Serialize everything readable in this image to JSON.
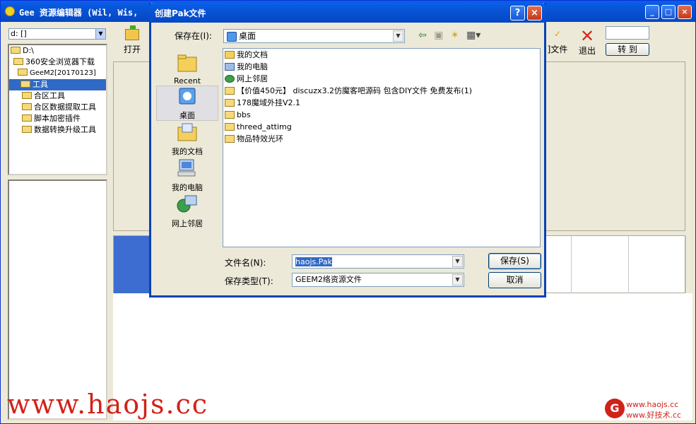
{
  "main_window": {
    "title": "Gee 资源编辑器 (Wil, Wis,",
    "controls": {
      "minimize": "_",
      "maximize": "□",
      "close": "×"
    }
  },
  "left_panel": {
    "drive": "d: []",
    "tree": [
      {
        "label": "D:\\",
        "selected": false
      },
      {
        "label": "360安全浏览器下载",
        "selected": false
      },
      {
        "label": "GeeM2[20170123]",
        "selected": false
      },
      {
        "label": "工具",
        "selected": true
      },
      {
        "label": "合区工具",
        "selected": false
      },
      {
        "label": "合区数据提取工具",
        "selected": false
      },
      {
        "label": "脚本加密插件",
        "selected": false
      },
      {
        "label": "数据转换升级工具",
        "selected": false
      }
    ]
  },
  "toolbar": {
    "open_label": "打开",
    "file_label": "]文件",
    "exit_label": "退出",
    "goto_value": "",
    "goto_label": "转 到"
  },
  "dialog": {
    "title": "创建Pak文件",
    "help": "?",
    "close": "×",
    "save_in_label": "保存在(I):",
    "save_in_value": "桌面",
    "places": [
      "Recent",
      "桌面",
      "我的文档",
      "我的电脑",
      "网上邻居"
    ],
    "files": [
      {
        "name": "我的文档",
        "icon": "my-documents-icon"
      },
      {
        "name": "我的电脑",
        "icon": "my-computer-icon"
      },
      {
        "name": "网上邻居",
        "icon": "network-icon"
      },
      {
        "name": "【价值450元】 discuzx3.2仿魔客吧源码 包含DIY文件 免费发布(1)",
        "icon": "folder-icon"
      },
      {
        "name": "178魔域外挂V2.1",
        "icon": "folder-icon"
      },
      {
        "name": "bbs",
        "icon": "folder-icon"
      },
      {
        "name": "threed_attimg",
        "icon": "folder-icon"
      },
      {
        "name": "物品特效光环",
        "icon": "folder-icon"
      }
    ],
    "filename_label": "文件名(N):",
    "filename_value": "haojs.Pak",
    "filetype_label": "保存类型(T):",
    "filetype_value": "GEEM2络资源文件",
    "save_button": "保存(S)",
    "cancel_button": "取消"
  },
  "watermark": {
    "left": "www.haojs.cc",
    "right_line1": "www.haojs.cc",
    "right_line2": "www.好技术.cc"
  }
}
